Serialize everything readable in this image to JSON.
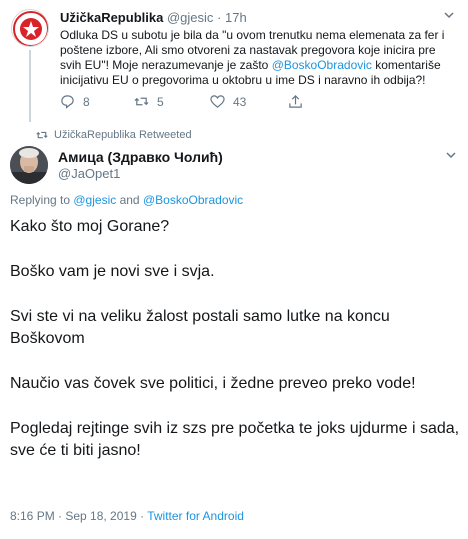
{
  "parent_tweet": {
    "display_name": "UžičkaRepublika",
    "handle": "@gjesic",
    "separator": "·",
    "time": "17h",
    "avatar_text": "УЖИЧКА РЕПУБЛИКА",
    "text_part1": "Odluka DS u subotu je bila da \"u ovom trenutku nema elemenata za fer i poštene izbore, Ali smo otvoreni za nastavak pregovora koje inicira pre svih EU\"! Moje nerazumevanje je zašto ",
    "mention": "@BoskoObradovic",
    "text_part2": " komentariše inicijativu EU o pregovorima u oktobru u ime DS i naravno ih odbija?!",
    "reply_count": "8",
    "retweet_count": "5",
    "like_count": "43"
  },
  "retweet_banner": "UžičkaRepublika Retweeted",
  "main_tweet": {
    "display_name": "Амица (Здравко Чолић)",
    "handle": "@JaOpet1",
    "replying_prefix": "Replying to ",
    "reply_mention1": "@gjesic",
    "replying_and": " and ",
    "reply_mention2": "@BoskoObradovic",
    "paragraphs": [
      "Kako što moj Gorane?",
      "Boško vam je novi sve i svja.",
      "Svi ste vi na veliku žalost postali samo lutke na koncu Boškovom",
      "Naučio vas čovek sve politici,  i žedne preveo preko vode!",
      "Pogledaj rejtinge svih iz szs pre početka te joks ujdurme i sada,  sve će ti biti jasno!"
    ],
    "timestamp": "8:16 PM · Sep 18, 2019 · ",
    "source": "Twitter for Android"
  },
  "colors": {
    "link": "#1b95e0",
    "muted": "#657786",
    "text": "#14171a",
    "logo_red": "#d8232a"
  }
}
